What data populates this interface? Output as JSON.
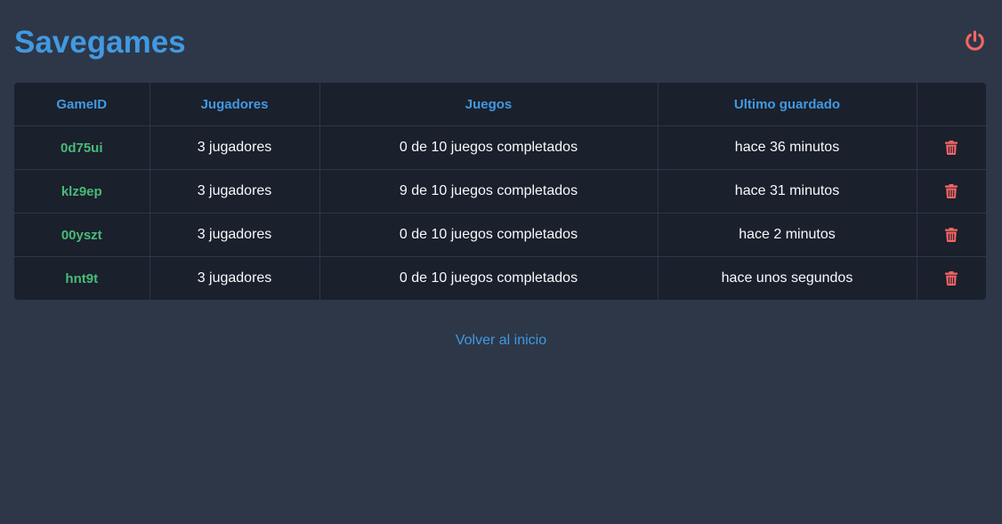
{
  "header": {
    "title": "Savegames",
    "power_icon": "power-icon",
    "power_color": "#f56565",
    "title_color": "#4299e1"
  },
  "table": {
    "columns": [
      "GameID",
      "Jugadores",
      "Juegos",
      "Ultimo guardado",
      ""
    ],
    "rows": [
      {
        "game_id": "0d75ui",
        "players": "3 jugadores",
        "games": "0 de 10 juegos completados",
        "last_saved": "hace 36 minutos"
      },
      {
        "game_id": "klz9ep",
        "players": "3 jugadores",
        "games": "9 de 10 juegos completados",
        "last_saved": "hace 31 minutos"
      },
      {
        "game_id": "00yszt",
        "players": "3 jugadores",
        "games": "0 de 10 juegos completados",
        "last_saved": "hace 2 minutos"
      },
      {
        "game_id": "hnt9t",
        "players": "3 jugadores",
        "games": "0 de 10 juegos completados",
        "last_saved": "hace unos segundos"
      }
    ],
    "delete_icon": "trash-icon",
    "id_color": "#48bb78"
  },
  "footer": {
    "back_link": "Volver al inicio"
  }
}
